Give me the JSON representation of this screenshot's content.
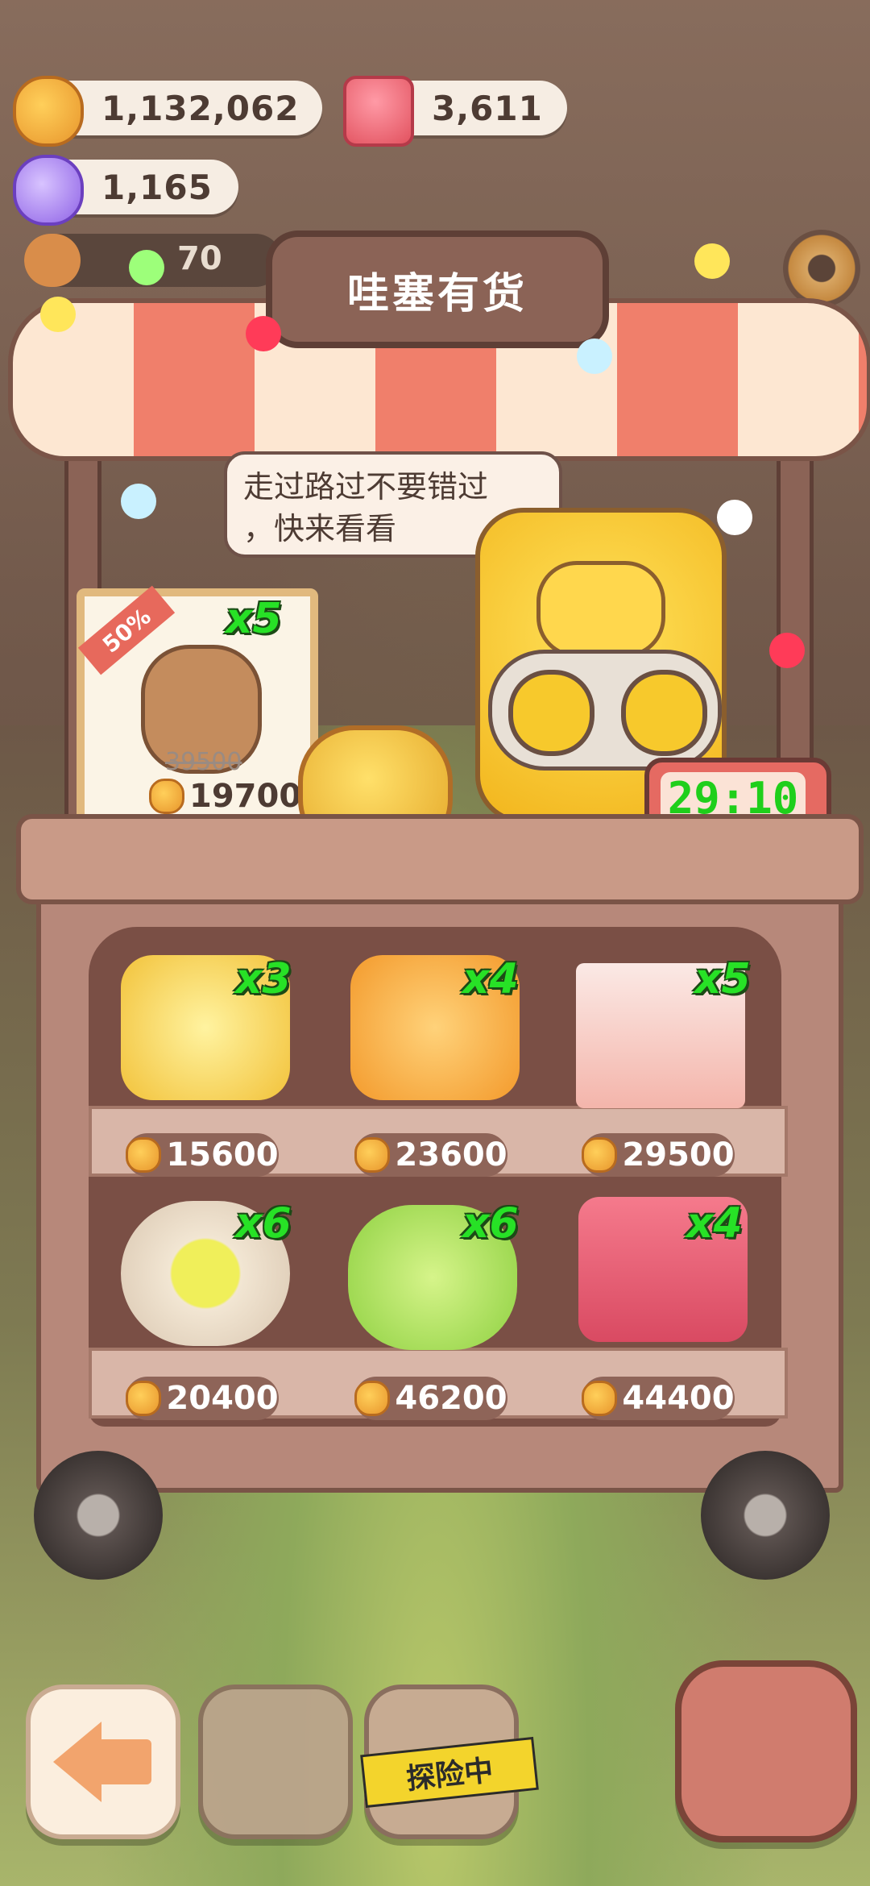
{
  "resources": {
    "cookies": "1,132,062",
    "candles": "3,611",
    "candy": "1,165"
  },
  "announcement": {
    "count": "70"
  },
  "shop": {
    "title": "哇塞有货",
    "speech_line1": "走过路过不要错过",
    "speech_line2": "，快来看看",
    "timer": "29:10"
  },
  "featured": {
    "discount": "50%",
    "qty": "x5",
    "old_price": "39500",
    "new_price": "19700"
  },
  "items": [
    {
      "icon": "spoon-fork-icon",
      "qty": "x3",
      "price": "15600"
    },
    {
      "icon": "sleep-slippers-icon",
      "qty": "x4",
      "price": "23600"
    },
    {
      "icon": "magazine-icon",
      "qty": "x5",
      "price": "29500"
    },
    {
      "icon": "tea-cup-icon",
      "qty": "x6",
      "price": "20400"
    },
    {
      "icon": "soap-icon",
      "qty": "x6",
      "price": "46200"
    },
    {
      "icon": "storybook-icon",
      "qty": "x4",
      "price": "44400"
    }
  ],
  "buttons": {
    "explore_label": "探险中"
  },
  "colors": {
    "qty_green": "#27e126",
    "timer_green": "#1fcf1b",
    "awning_red": "#f07f6b"
  }
}
